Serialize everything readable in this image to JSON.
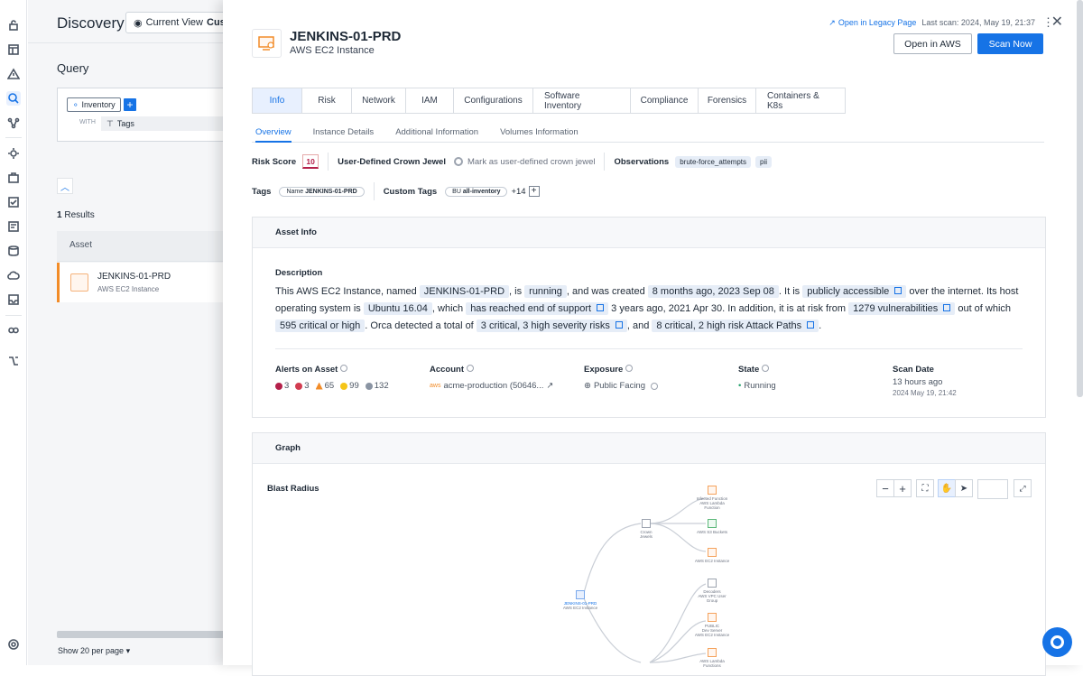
{
  "background": {
    "title": "Discovery",
    "current_view_label": "Current View",
    "current_view_value": "Custo",
    "query_title": "Query",
    "inventory_label": "Inventory",
    "with_label": "WITH",
    "tags_label": "Tags",
    "results_count": "1",
    "results_label": "Results",
    "asset_column": "Asset",
    "asset_row": {
      "name": "JENKINS-01-PRD",
      "type": "AWS EC2 Instance"
    },
    "per_page": "Show 20 per page"
  },
  "panel": {
    "legacy_link": "Open in Legacy Page",
    "last_scan": "Last scan: 2024, May 19, 21:37",
    "asset_name": "JENKINS-01-PRD",
    "asset_type": "AWS EC2 Instance",
    "open_in_aws": "Open in AWS",
    "scan_now": "Scan Now",
    "tabs": [
      "Info",
      "Risk",
      "Network",
      "IAM",
      "Configurations",
      "Software Inventory",
      "Compliance",
      "Forensics",
      "Containers & K8s"
    ],
    "subtabs": [
      "Overview",
      "Instance Details",
      "Additional Information",
      "Volumes Information"
    ],
    "risk_score_label": "Risk Score",
    "risk_score": "10",
    "crown_jewel_label": "User-Defined Crown Jewel",
    "crown_jewel_action": "Mark as user-defined crown jewel",
    "observations_label": "Observations",
    "observations": [
      "brute-force_attempts",
      "pii"
    ],
    "tags_label": "Tags",
    "tag_name_key": "Name",
    "tag_name_value": "JENKINS-01-PRD",
    "custom_tags_label": "Custom Tags",
    "custom_tag_key": "BU",
    "custom_tag_value": "all-inventory",
    "custom_tags_more": "+14",
    "asset_info_title": "Asset Info",
    "description_label": "Description",
    "desc": {
      "t1": "This AWS EC2 Instance, named ",
      "h1": "JENKINS-01-PRD",
      "t2": ", is ",
      "h2": "running",
      "t3": ", and was created ",
      "h3": "8 months ago, 2023 Sep 08",
      "t4": ". It is ",
      "h4": "publicly accessible",
      "t5": " over the internet. Its host operating system is ",
      "h5": "Ubuntu 16.04",
      "t6": ", which ",
      "h6": "has reached end of support",
      "t7": " 3 years ago, 2021 Apr 30. In addition, it is at risk from ",
      "h7": "1279 vulnerabilities",
      "t8": " out of which ",
      "h8": "595 critical or high",
      "t9": ". Orca detected a total of ",
      "h9": "3 critical, 3 high severity risks",
      "t10": ", and ",
      "h10": "8 critical, 2 high risk Attack Paths",
      "t11": "."
    },
    "alerts_label": "Alerts on Asset",
    "alerts": [
      {
        "count": "3",
        "color": "#b4204a"
      },
      {
        "count": "3",
        "color": "#d23c50"
      },
      {
        "count": "65",
        "color": "#f28c28"
      },
      {
        "count": "99",
        "color": "#f5c518"
      },
      {
        "count": "132",
        "color": "#8a94a3"
      }
    ],
    "account_label": "Account",
    "account_value": "acme-production (50646...",
    "exposure_label": "Exposure",
    "exposure_value": "Public Facing",
    "state_label": "State",
    "state_value": "Running",
    "scan_date_label": "Scan Date",
    "scan_date_rel": "13 hours ago",
    "scan_date_abs": "2024 May 19, 21:42",
    "graph_title": "Graph",
    "blast_radius": "Blast Radius",
    "graph_nodes": {
      "center": [
        "JENKINS-01-PRD",
        "AWS EC2 Instance"
      ],
      "crown": [
        "Crown",
        "Jewels"
      ],
      "n1": [
        "Infected Function",
        "AWS Lambda Function"
      ],
      "n2": [
        "AWS S3 Buckets"
      ],
      "n3": [
        "AWS EC2 Instance"
      ],
      "n4": [
        "Decoders",
        "AWS VPC User Group"
      ],
      "n5": [
        "PUBLIC",
        "Dev Server",
        "AWS EC2 Instance"
      ],
      "n6": [
        "AWS Lambda Functions"
      ]
    }
  },
  "colors": {
    "accent": "#1673e6",
    "risk": "#b4204a",
    "selected_border": "#f28c28"
  }
}
